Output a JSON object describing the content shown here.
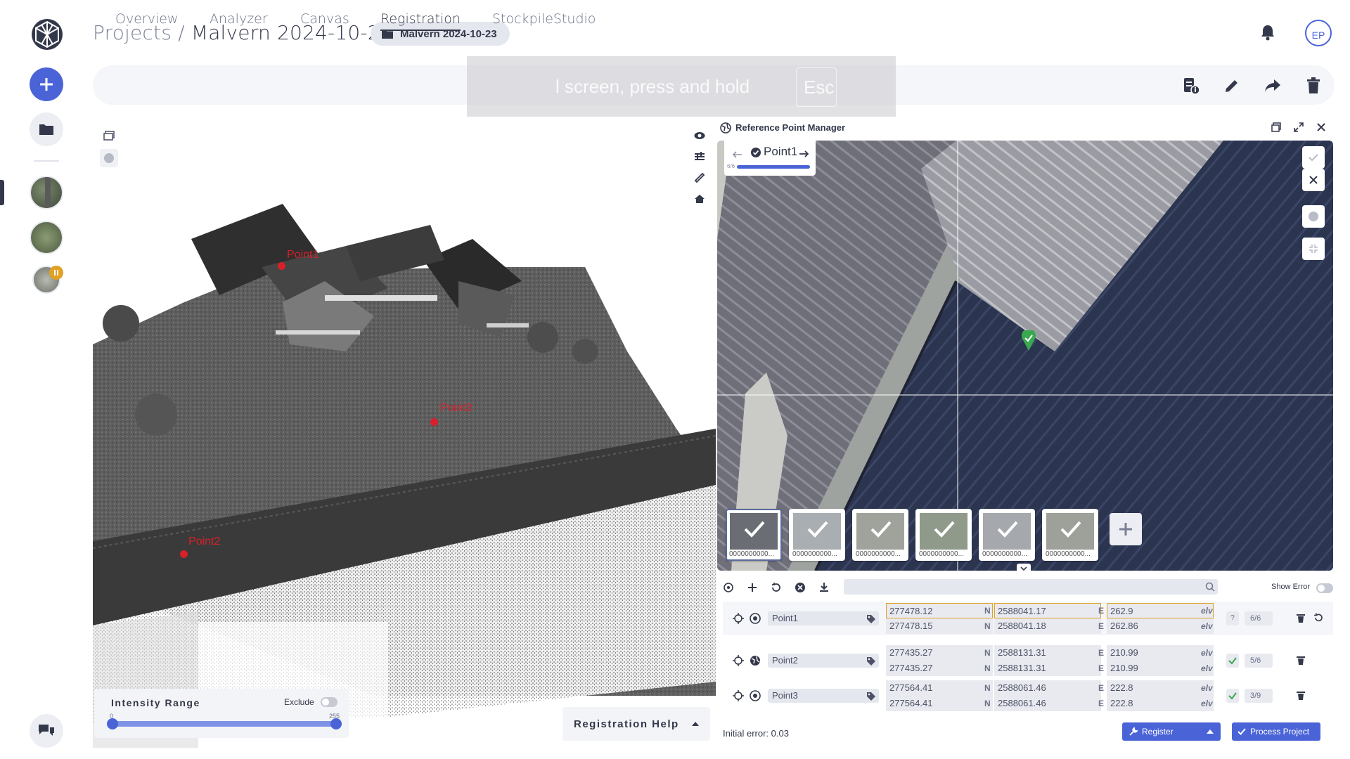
{
  "header": {
    "breadcrumb_root": "Projects /",
    "breadcrumb_current": "Malvern 2024-10-23",
    "project_chip": "Malvern 2024-10-23",
    "user_initials": "EP"
  },
  "tabs": [
    {
      "label": "Overview",
      "active": false
    },
    {
      "label": "Analyzer",
      "active": false
    },
    {
      "label": "Canvas",
      "active": false
    },
    {
      "label": "Registration",
      "active": true
    },
    {
      "label": "StockpileStudio",
      "active": false
    }
  ],
  "fullscreen_toast": {
    "text": "l screen, press and hold",
    "key": "Esc"
  },
  "viewer": {
    "point_labels": [
      "Point1",
      "Point3",
      "Point2"
    ],
    "intensity": {
      "title": "Intensity Range",
      "exclude_label": "Exclude",
      "min": "0",
      "max": "255"
    },
    "help_label": "Registration Help"
  },
  "rpm": {
    "title": "Reference Point Manager",
    "current_point": "Point1",
    "progress_text": "6/6",
    "progress": 1.0,
    "thumbnails": [
      "0000000000...",
      "0000000000...",
      "0000000000...",
      "0000000000...",
      "0000000000...",
      "0000000000..."
    ],
    "show_error_label": "Show Error",
    "initial_error": "Initial error: 0.03",
    "register_label": "Register",
    "process_label": "Process Project"
  },
  "points": [
    {
      "name": "Point1",
      "n1": "277478.12",
      "e1": "2588041.17",
      "z1": "262.9",
      "n2": "277478.15",
      "e2": "2588041.18",
      "z2": "262.86",
      "count": "6/6",
      "status": "?"
    },
    {
      "name": "Point2",
      "n1": "277435.27",
      "e1": "2588131.31",
      "z1": "210.99",
      "n2": "277435.27",
      "e2": "2588131.31",
      "z2": "210.99",
      "count": "5/6",
      "status": "check"
    },
    {
      "name": "Point3",
      "n1": "277564.41",
      "e1": "2588061.46",
      "z1": "222.8",
      "n2": "277564.41",
      "e2": "2588061.46",
      "z2": "222.8",
      "count": "3/9",
      "status": "check"
    }
  ],
  "labels": {
    "n": "N",
    "e": "E",
    "elv": "elv"
  },
  "colors": {
    "accent": "#4a64d8",
    "point_marker": "#d8202a",
    "success": "#3aa84f",
    "warning": "#e0a126"
  }
}
